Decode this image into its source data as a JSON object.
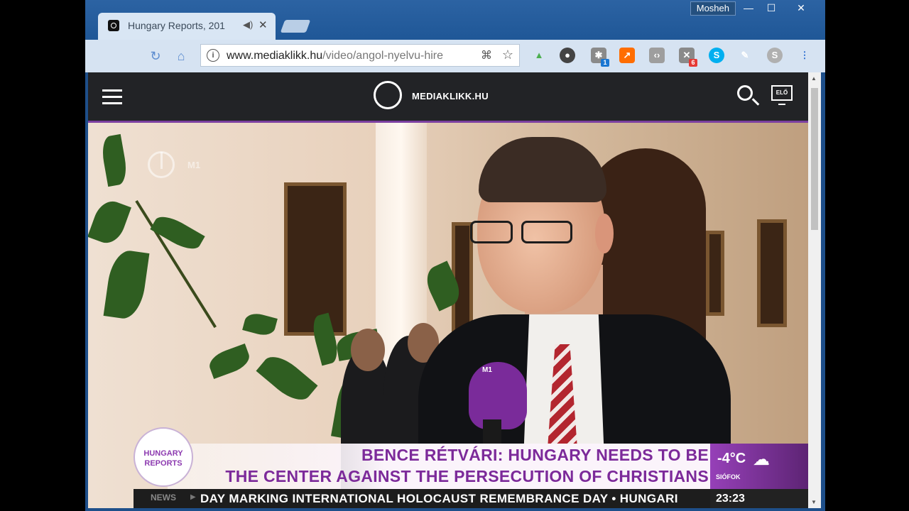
{
  "browser": {
    "user_name": "Mosheh",
    "window_controls": {
      "minimize": "—",
      "maximize": "☐",
      "close": "✕"
    },
    "tabs": [
      {
        "title": "Hungary Reports, 201",
        "audio_icon": "speaker-icon",
        "close": "✕"
      }
    ],
    "toolbar": {
      "reload_icon": "reload-icon",
      "home_icon": "home-icon",
      "url_domain": "www.mediaklikk.hu",
      "url_path": "/video/angol-nyelvu-hire",
      "extensions": [
        {
          "name": "chart-extension-icon",
          "color": "#4caf50"
        },
        {
          "name": "chat-extension-icon",
          "color": "#444444"
        },
        {
          "name": "puzzle-extension-icon",
          "color": "#777777",
          "badge": "1"
        },
        {
          "name": "trend-extension-icon",
          "color": "#ff6d00"
        },
        {
          "name": "code-extension-icon",
          "color": "#9e9e9e"
        },
        {
          "name": "gear-extension-icon",
          "color": "#777777",
          "badge": "6"
        },
        {
          "name": "skype-extension-icon",
          "color": "#00aff0",
          "label": "S"
        },
        {
          "name": "brush-extension-icon",
          "color": "#ffffff"
        },
        {
          "name": "skype-grey-extension-icon",
          "color": "#b0b0b0",
          "label": "S"
        },
        {
          "name": "menu-extension-icon",
          "color": "#2d6fd0"
        }
      ]
    }
  },
  "site": {
    "logo_text": "MEDIAKLIKK.HU",
    "live_label": "ELŐ",
    "watermark": "M1"
  },
  "video": {
    "badge_line1": "HUNGARY",
    "badge_line2": "REPORTS",
    "headline_line1": "BENCE RÉTVÁRI: HUNGARY NEEDS TO BE",
    "headline_line2": "THE CENTER AGAINST THE PERSECUTION OF CHRISTIANS",
    "weather_temp": "-4°C",
    "weather_location": "SIÓFOK",
    "ticker_label": "NEWS",
    "ticker_text": "DAY MARKING INTERNATIONAL HOLOCAUST REMEMBRANCE DAY  •  HUNGARI",
    "clock": "23:23",
    "mic_label": "M1"
  }
}
